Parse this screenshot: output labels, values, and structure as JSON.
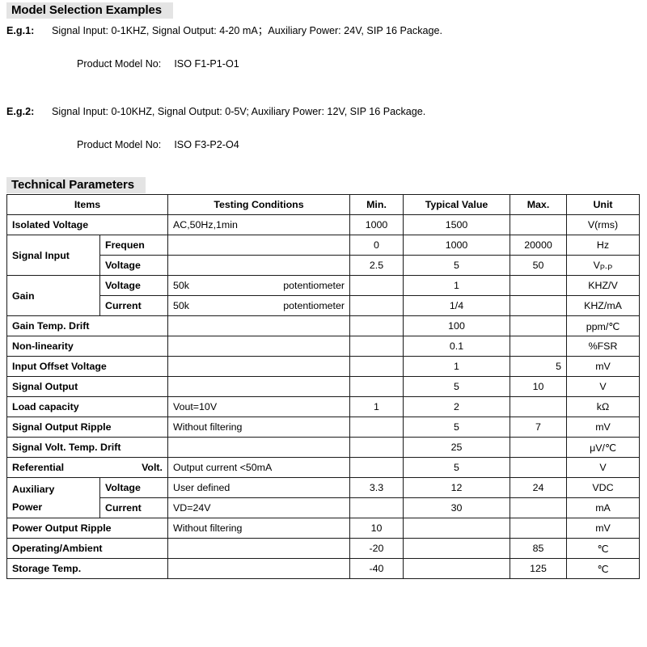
{
  "model_section": {
    "heading": "Model Selection Examples",
    "examples": [
      {
        "label": "E.g.1:",
        "text": "Signal Input: 0-1KHZ, Signal Output: 4-20 mA；Auxiliary Power: 24V, SIP 16 Package.",
        "model_label": "Product Model No:",
        "model_value": "ISO F1-P1-O1"
      },
      {
        "label": "E.g.2:",
        "text": "Signal Input: 0-10KHZ, Signal Output: 0-5V; Auxiliary Power: 12V, SIP 16 Package.",
        "model_label": "Product Model No:",
        "model_value": "ISO F3-P2-O4"
      }
    ]
  },
  "tech_section": {
    "heading": "Technical Parameters",
    "columns": {
      "items": "Items",
      "testing_conditions": "Testing Conditions",
      "min": "Min.",
      "typical": "Typical Value",
      "max": "Max.",
      "unit": "Unit"
    },
    "rows": [
      {
        "item": "Isolated Voltage",
        "sub": "",
        "conditions": "AC,50Hz,1min",
        "min": "1000",
        "typical": "1500",
        "max": "",
        "unit": "V(rms)"
      },
      {
        "item": "Signal Input",
        "sub": "Frequen",
        "conditions": "",
        "min": "0",
        "typical": "1000",
        "max": "20000",
        "unit": "Hz"
      },
      {
        "item": "",
        "sub": "Voltage",
        "conditions": "",
        "min": "2.5",
        "typical": "5",
        "max": "50",
        "unit": "V",
        "unit_sub": "P-P"
      },
      {
        "item": "Gain",
        "sub": "Voltage",
        "cond_left": "50k",
        "cond_right": "potentiometer",
        "min": "",
        "typical": "1",
        "max": "",
        "unit": "KHZ/V"
      },
      {
        "item": "",
        "sub": "Current",
        "cond_left": "50k",
        "cond_right": "potentiometer",
        "min": "",
        "typical": "1/4",
        "max": "",
        "unit": "KHZ/mA"
      },
      {
        "item": "Gain Temp. Drift",
        "sub": "",
        "conditions": "",
        "min": "",
        "typical": "100",
        "max": "",
        "unit": "ppm/℃"
      },
      {
        "item": "Non-linearity",
        "sub": "",
        "conditions": "",
        "min": "",
        "typical": "0.1",
        "max": "",
        "unit": "%FSR"
      },
      {
        "item": "Input Offset Voltage",
        "sub": "",
        "conditions": "",
        "min": "",
        "typical": "1",
        "max": "5",
        "max_align": "right",
        "unit": "mV"
      },
      {
        "item": "Signal Output",
        "sub": "",
        "conditions": "",
        "min": "",
        "typical": "5",
        "max": "10",
        "unit": "V"
      },
      {
        "item": "Load capacity",
        "sub": "",
        "conditions": "Vout=10V",
        "min": "1",
        "typical": "2",
        "max": "",
        "unit": "kΩ"
      },
      {
        "item": "Signal Output Ripple",
        "sub": "",
        "conditions": "Without filtering",
        "min": "",
        "typical": "5",
        "max": "7",
        "unit": "mV"
      },
      {
        "item": "Signal Volt. Temp. Drift",
        "sub": "",
        "conditions": "",
        "min": "",
        "typical": "25",
        "max": "",
        "unit": "μV/℃"
      },
      {
        "item": "Referential",
        "item_right": "Volt.",
        "sub": "",
        "conditions": "Output current <50mA",
        "min": "",
        "typical": "5",
        "max": "",
        "unit": "V"
      },
      {
        "item": "Auxiliary",
        "item_line2": "Power",
        "sub": "Voltage",
        "conditions": "User defined",
        "min": "3.3",
        "typical": "12",
        "max": "24",
        "unit": "VDC"
      },
      {
        "item": "",
        "sub": "Current",
        "conditions": "VD=24V",
        "min": "",
        "typical": "30",
        "max": "",
        "unit": "mA"
      },
      {
        "item": "Power Output Ripple",
        "sub": "",
        "conditions": "Without filtering",
        "min": "10",
        "typical": "",
        "max": "",
        "unit": "mV"
      },
      {
        "item": "Operating/Ambient",
        "sub": "",
        "conditions": "",
        "min": "-20",
        "typical": "",
        "max": "85",
        "unit": "℃"
      },
      {
        "item": "Storage Temp.",
        "sub": "",
        "conditions": "",
        "min": "-40",
        "typical": "",
        "max": "125",
        "unit": "℃"
      }
    ]
  },
  "colors": {
    "heading_band": "#e4e4e4",
    "cell_shade": "#e2e2e2",
    "border": "#1a1a1a",
    "text": "#000000"
  }
}
